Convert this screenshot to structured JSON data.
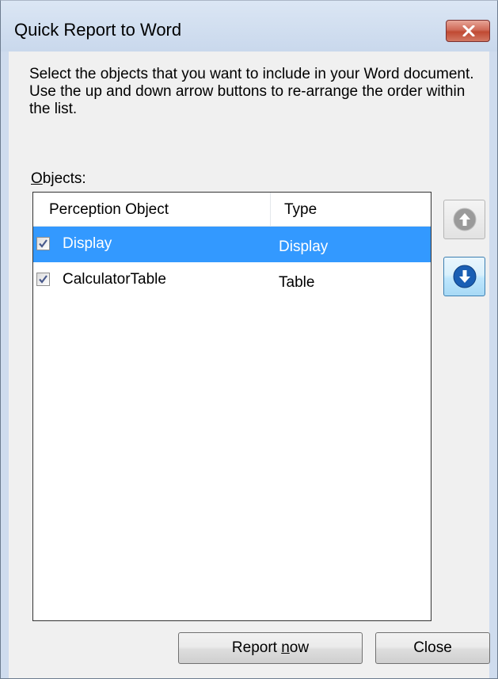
{
  "window": {
    "title": "Quick Report to Word"
  },
  "instructions": {
    "text": "Select the objects that you want to include in your Word document. Use the up and down arrow buttons to re-arrange the order within the list."
  },
  "objects": {
    "label_mnemonic": "O",
    "label_rest": "bjects:",
    "columns": [
      "Perception Object",
      "Type"
    ],
    "rows": [
      {
        "checked": true,
        "name": "Display",
        "type": "Display",
        "selected": true
      },
      {
        "checked": true,
        "name": "CalculatorTable",
        "type": "Table",
        "selected": false
      }
    ]
  },
  "side_buttons": {
    "up_icon": "arrow-up-circle-icon",
    "up_enabled": false,
    "down_icon": "arrow-down-circle-icon",
    "down_enabled": true
  },
  "buttons": {
    "report_prefix": "Report ",
    "report_mnemonic": "n",
    "report_suffix": "ow",
    "close": "Close"
  },
  "colors": {
    "selection": "#3399ff",
    "close_button": "#c75050",
    "down_arrow": "#1a5fb4"
  }
}
